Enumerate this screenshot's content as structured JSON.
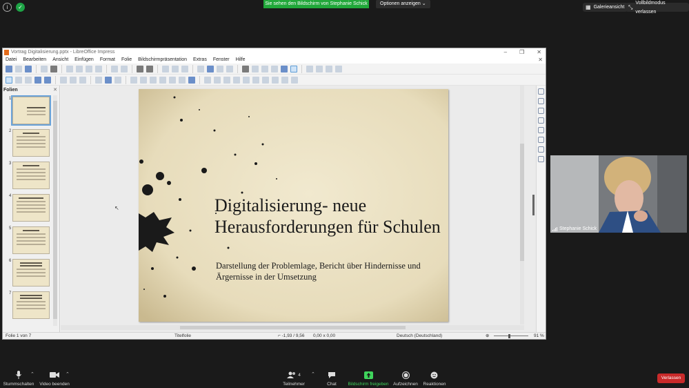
{
  "zoom": {
    "share_banner": "Sie sehen den Bildschirm von Stephanie Schick",
    "options_label": "Optionen anzeigen",
    "gallery_label": "Galerieansicht",
    "fullscreen_exit_label": "Vollbildmodus verlassen",
    "participant_name": "Stephanie Schick",
    "participants_count": "4",
    "toolbar": [
      {
        "label": "Stummschalten"
      },
      {
        "label": "Video beenden"
      },
      {
        "label": "Teilnehmer"
      },
      {
        "label": "Chat"
      },
      {
        "label": "Bildschirm freigeben"
      },
      {
        "label": "Aufzeichnen"
      },
      {
        "label": "Reaktionen"
      }
    ],
    "leave_label": "Verlassen",
    "colors": {
      "share_green": "#21a83a",
      "leave_red": "#c92a2a"
    }
  },
  "impress": {
    "window_title": "Vortrag Digitalisierung.pptx - LibreOffice Impress",
    "menu": [
      "Datei",
      "Bearbeiten",
      "Ansicht",
      "Einfügen",
      "Format",
      "Folie",
      "Bildschirmpräsentation",
      "Extras",
      "Fenster",
      "Hilfe"
    ],
    "panel_title": "Folien",
    "slides": [
      {
        "num": "1"
      },
      {
        "num": "2"
      },
      {
        "num": "3"
      },
      {
        "num": "4"
      },
      {
        "num": "5"
      },
      {
        "num": "6"
      },
      {
        "num": "7"
      }
    ],
    "current_slide": {
      "title": "Digitalisierung- neue Herausforderungen für Schulen",
      "subtitle": "Darstellung der Problemlage, Bericht über Hindernisse und Ärgernisse in der Umsetzung"
    },
    "status": {
      "slide_pos": "Folie 1 von 7",
      "layout": "Titelfolie",
      "position": "-1,93 / 9,56",
      "size": "0,00 x 0,00",
      "language": "Deutsch (Deutschland)",
      "zoom": "91 %"
    }
  }
}
